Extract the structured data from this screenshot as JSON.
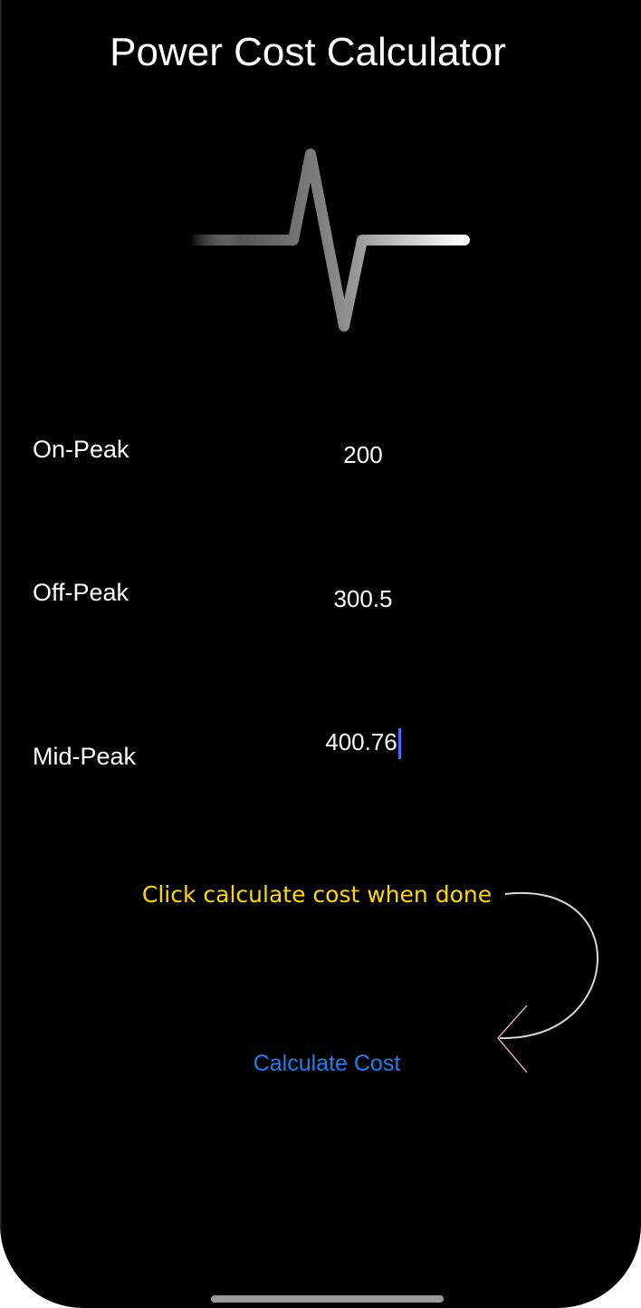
{
  "app": {
    "title": "Power Cost Calculator"
  },
  "header_icon": "heartbeat-pulse-icon",
  "fields": [
    {
      "label": "On-Peak",
      "value": "200"
    },
    {
      "label": "Off-Peak",
      "value": "300.5"
    },
    {
      "label": "Mid-Peak",
      "value": "400.76"
    }
  ],
  "hint": {
    "text": "Click calculate cost when done",
    "color": "#FFD800",
    "arrow_icon": "curved-arrow-left-icon"
  },
  "actions": {
    "calculate_label": "Calculate Cost",
    "color": "#1A80F2"
  },
  "colors": {
    "background": "#000000",
    "text": "#FFFFFF",
    "caret": "#4A6CF7"
  }
}
